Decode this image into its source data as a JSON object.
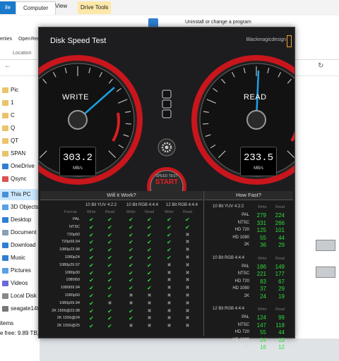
{
  "explorer": {
    "tabs": {
      "file": "ile",
      "computer": "Computer",
      "view": "View",
      "drive_tools": "Drive Tools"
    },
    "ribbon": {
      "properties": "erties",
      "open": "Open",
      "rename": "Ren",
      "location": "Location",
      "uninstall": "Uninstall or change a program"
    },
    "nav": [
      {
        "label": "Pic",
        "color": "#e9c46a"
      },
      {
        "label": "1",
        "color": "#e9c46a"
      },
      {
        "label": "C",
        "color": "#e9c46a"
      },
      {
        "label": "Q",
        "color": "#e9c46a"
      },
      {
        "label": "QT",
        "color": "#e9c46a"
      },
      {
        "label": "SPAN",
        "color": "#e9c46a"
      },
      {
        "label": "OneDrive",
        "color": "#2f7fd1"
      },
      {
        "label": "Qsync",
        "color": "#d9534f"
      },
      {
        "label": "This PC",
        "color": "#4a90d9"
      },
      {
        "label": "3D Objects",
        "color": "#5aa0e6"
      },
      {
        "label": "Desktop",
        "color": "#2f7fd1"
      },
      {
        "label": "Document",
        "color": "#8aa0b8"
      },
      {
        "label": "Download",
        "color": "#2f7fd1"
      },
      {
        "label": "Music",
        "color": "#2f7fd1"
      },
      {
        "label": "Pictures",
        "color": "#5aa0e6"
      },
      {
        "label": "Videos",
        "color": "#6a6ad6"
      },
      {
        "label": "Local Disk",
        "color": "#888888"
      },
      {
        "label": "seagate14t",
        "color": "#777777"
      }
    ],
    "status": {
      "items": "items",
      "space": "e free: 9.89 TB,",
      "drive_label": "9"
    }
  },
  "app": {
    "title": "Disk Speed Test",
    "brand": "Blackmagicdesign",
    "write_gauge": {
      "label": "WRITE",
      "value": "303.2",
      "unit": "MB/s"
    },
    "read_gauge": {
      "label": "READ",
      "value": "233.5",
      "unit": "MB/s"
    },
    "start": {
      "top": "SPEED TEST",
      "main": "START"
    },
    "accent": "#e31e24",
    "needle": "#1aa3e8",
    "ok_color": "#2edb3a"
  },
  "will_it_work": {
    "title": "Will it Work?",
    "groups": [
      "10 Bit YUV 4:2:2",
      "10 Bit RGB 4:4:4",
      "12 Bit RGB 4:4:4"
    ],
    "format_header": "Format",
    "write_header": "Write",
    "read_header": "Read",
    "rows": [
      {
        "format": "PAL",
        "marks": [
          1,
          1,
          1,
          1,
          1,
          1
        ]
      },
      {
        "format": "NTSC",
        "marks": [
          1,
          1,
          1,
          1,
          1,
          1
        ]
      },
      {
        "format": "720p50",
        "marks": [
          1,
          1,
          1,
          1,
          1,
          0
        ]
      },
      {
        "format": "720p59.94",
        "marks": [
          1,
          1,
          1,
          1,
          1,
          0
        ]
      },
      {
        "format": "1080p23.98",
        "marks": [
          1,
          1,
          1,
          1,
          1,
          0
        ]
      },
      {
        "format": "1080p24",
        "marks": [
          1,
          1,
          1,
          1,
          1,
          0
        ]
      },
      {
        "format": "1080p29.97",
        "marks": [
          1,
          1,
          1,
          1,
          0,
          0
        ]
      },
      {
        "format": "1080p30",
        "marks": [
          1,
          1,
          1,
          1,
          0,
          0
        ]
      },
      {
        "format": "1080i50",
        "marks": [
          1,
          1,
          1,
          1,
          0,
          0
        ]
      },
      {
        "format": "1080i59.94",
        "marks": [
          1,
          1,
          1,
          1,
          0,
          0
        ]
      },
      {
        "format": "1080p50",
        "marks": [
          1,
          1,
          0,
          0,
          0,
          0
        ]
      },
      {
        "format": "1080p59.94",
        "marks": [
          1,
          0,
          0,
          0,
          0,
          0
        ]
      },
      {
        "format": "2K 1556@23.98",
        "marks": [
          1,
          1,
          1,
          0,
          0,
          0
        ]
      },
      {
        "format": "2K 1556@24",
        "marks": [
          1,
          1,
          1,
          0,
          0,
          0
        ]
      },
      {
        "format": "2K 1556@25",
        "marks": [
          1,
          1,
          0,
          0,
          0,
          0
        ]
      }
    ]
  },
  "how_fast": {
    "title": "How Fast?",
    "write_header": "Write",
    "read_header": "Read",
    "sections": [
      {
        "name": "10 Bit YUV 4:2:2",
        "rows": [
          {
            "label": "PAL",
            "write": "279",
            "read": "224"
          },
          {
            "label": "NTSC",
            "write": "331",
            "read": "266"
          },
          {
            "label": "HD 720",
            "write": "125",
            "read": "101"
          },
          {
            "label": "HD 1080",
            "write": "55",
            "read": "44"
          },
          {
            "label": "2K",
            "write": "36",
            "read": "29"
          }
        ]
      },
      {
        "name": "10 Bit RGB 4:4:4",
        "rows": [
          {
            "label": "PAL",
            "write": "186",
            "read": "149"
          },
          {
            "label": "NTSC",
            "write": "221",
            "read": "177"
          },
          {
            "label": "HD 720",
            "write": "83",
            "read": "67"
          },
          {
            "label": "HD 1080",
            "write": "37",
            "read": "29"
          },
          {
            "label": "2K",
            "write": "24",
            "read": "19"
          }
        ]
      },
      {
        "name": "12 Bit RGB 4:4:4",
        "rows": [
          {
            "label": "PAL",
            "write": "124",
            "read": "99"
          },
          {
            "label": "NTSC",
            "write": "147",
            "read": "118"
          },
          {
            "label": "HD 720",
            "write": "55",
            "read": "44"
          },
          {
            "label": "HD 1080",
            "write": "24",
            "read": "19"
          },
          {
            "label": "2K",
            "write": "16",
            "read": "12"
          }
        ]
      }
    ]
  }
}
